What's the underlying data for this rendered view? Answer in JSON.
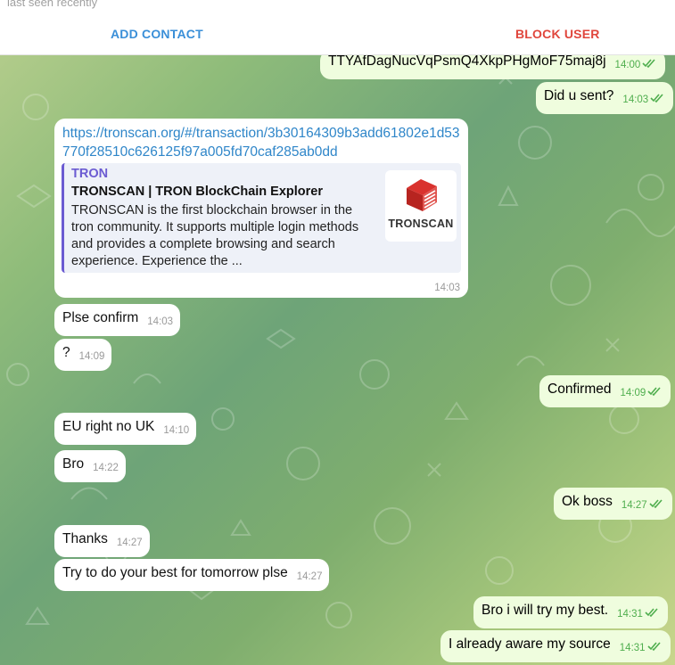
{
  "header": {
    "status": "last seen recently",
    "add_contact": "ADD CONTACT",
    "block_user": "BLOCK USER"
  },
  "colors": {
    "accent_blue": "#3a8fd8",
    "danger_red": "#e0463c",
    "outgoing_bubble": "#effdde",
    "incoming_bubble": "#ffffff",
    "link_preview_accent": "#6b5bd2"
  },
  "messages": [
    {
      "dir": "out",
      "text": "TTYAfDagNucVqPsmQ4XkpPHgMoF75maj8j",
      "time": "14:00",
      "read": true
    },
    {
      "dir": "out",
      "text": "Did u sent?",
      "time": "14:03",
      "read": true
    },
    {
      "dir": "in",
      "text": "Plse confirm",
      "time": "14:03"
    },
    {
      "dir": "in",
      "text": "?",
      "time": "14:09"
    },
    {
      "dir": "out",
      "text": "Confirmed",
      "time": "14:09",
      "read": true
    },
    {
      "dir": "in",
      "text": "EU right no UK",
      "time": "14:10"
    },
    {
      "dir": "in",
      "text": "Bro",
      "time": "14:22"
    },
    {
      "dir": "out",
      "text": "Ok boss",
      "time": "14:27",
      "read": true
    },
    {
      "dir": "in",
      "text": "Thanks",
      "time": "14:27"
    },
    {
      "dir": "in",
      "text": "Try to do your best for tomorrow plse",
      "time": "14:27"
    },
    {
      "dir": "out",
      "text": "Bro i will try my best.",
      "time": "14:31",
      "read": true
    },
    {
      "dir": "out",
      "text": "I already aware my source",
      "time": "14:31",
      "read": true
    }
  ],
  "link_message": {
    "url": "https://tronscan.org/#/transaction/3b30164309b3add61802e1d53770f28510c626125f97a005fd70caf285ab0dd",
    "site_name": "TRON",
    "title": "TRONSCAN | TRON BlockChain Explorer",
    "description": "TRONSCAN is the first blockchain browser in the tron community. It supports multiple login methods and provides a complete browsing and search experience. Experience the ...",
    "thumb_label": "TRONSCAN",
    "time": "14:03"
  }
}
